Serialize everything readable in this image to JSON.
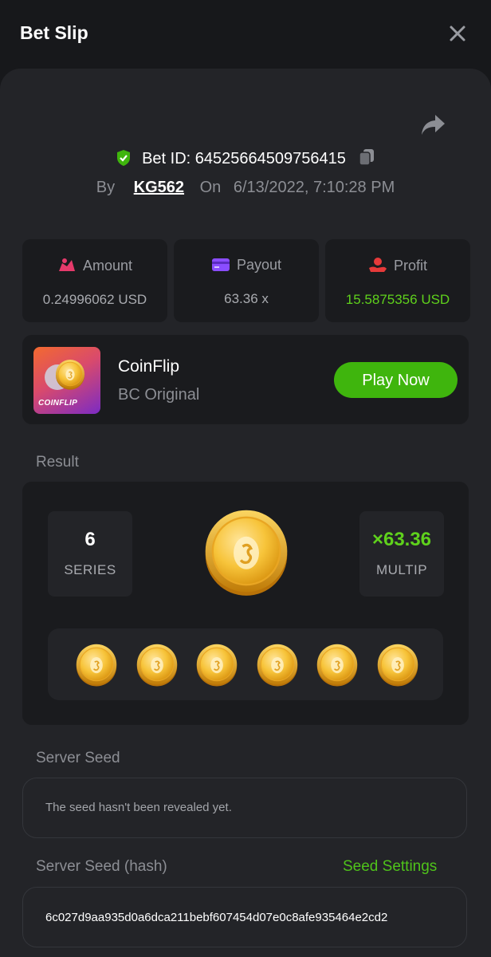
{
  "header": {
    "title": "Bet Slip"
  },
  "bet": {
    "id_prefix": "Bet ID:",
    "id": "64525664509756415",
    "by_label": "By",
    "username": "KG562",
    "on_label": "On",
    "date": "6/13/2022, 7:10:28 PM"
  },
  "stats": {
    "amount": {
      "label": "Amount",
      "value": "0.24996062 USD"
    },
    "payout": {
      "label": "Payout",
      "value": "63.36 x"
    },
    "profit": {
      "label": "Profit",
      "value": "15.5875356 USD"
    }
  },
  "game": {
    "name": "CoinFlip",
    "provider": "BC Original",
    "thumb_caption": "COINFLIP",
    "play_label": "Play Now"
  },
  "result": {
    "label": "Result",
    "series_value": "6",
    "series_label": "SERIES",
    "multiplier_value": "×63.36",
    "multiplier_label": "MULTIP",
    "coin_count": 6
  },
  "server_seed": {
    "label": "Server Seed",
    "text": "The seed hasn't been revealed yet."
  },
  "server_seed_hash": {
    "label": "Server Seed (hash)",
    "settings_label": "Seed Settings",
    "hash": "6c027d9aa935d0a6dca211bebf607454d07e0c8afe935464e2cd2"
  },
  "icons": {
    "close": "close-icon",
    "share": "share-icon",
    "verified": "shield-check-icon",
    "copy": "copy-icon",
    "amount": "amount-icon",
    "payout": "card-icon",
    "profit": "profit-icon",
    "coin": "coin-icon"
  },
  "colors": {
    "accent_green": "#3fb50d",
    "profit_green": "#5fd11c",
    "background": "#17181b",
    "panel": "#232428",
    "card": "#1a1b1e"
  }
}
